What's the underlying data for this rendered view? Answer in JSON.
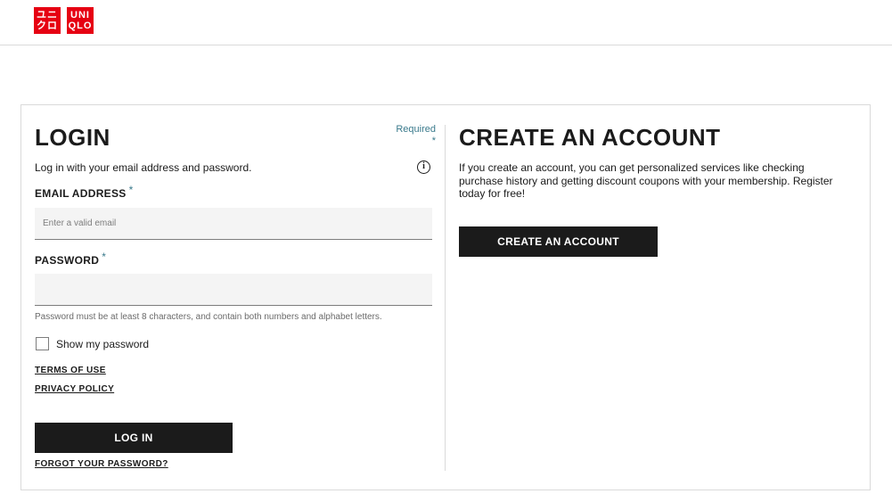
{
  "header": {
    "logo_top": "UNI",
    "logo_bottom": "QLO",
    "logo_katakana_top": "ユニ",
    "logo_katakana_bottom": "クロ",
    "brand_color": "#e60012"
  },
  "login": {
    "title": "LOGIN",
    "required_note": "Required",
    "required_mark": "*",
    "description": "Log in with your email address and password.",
    "info_icon": "info-icon",
    "email_label": "EMAIL ADDRESS",
    "email_placeholder": "Enter a valid email",
    "email_value": "",
    "password_label": "PASSWORD",
    "password_value": "",
    "password_hint": "Password must be at least 8 characters, and contain both numbers and alphabet letters.",
    "show_password_label": "Show my password",
    "show_password_checked": false,
    "terms_link": "TERMS OF USE",
    "privacy_link": "PRIVACY POLICY",
    "login_button": "LOG IN",
    "forgot_link": "FORGOT YOUR PASSWORD?"
  },
  "create_account": {
    "title": "CREATE AN ACCOUNT",
    "description": "If you create an account, you can get personalized services like checking purchase history and getting discount coupons with your membership. Register today for free!",
    "button": "CREATE AN ACCOUNT"
  },
  "colors": {
    "accent_teal": "#3a7a8c",
    "button_dark": "#1b1b1b"
  }
}
